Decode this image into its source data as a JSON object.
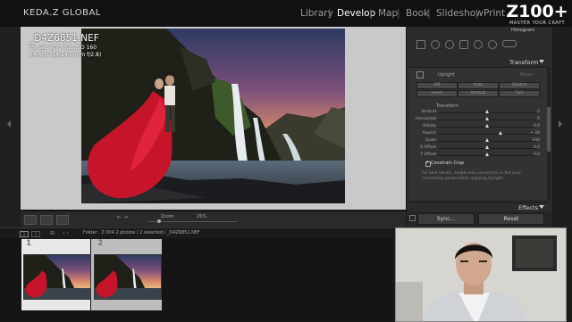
{
  "app": {
    "brand": "KEDA.Z GLOBAL"
  },
  "modules": [
    {
      "label": "Library",
      "active": false
    },
    {
      "label": "Develop",
      "active": true
    },
    {
      "label": "Map",
      "active": false
    },
    {
      "label": "Book",
      "active": false
    },
    {
      "label": "Slideshow",
      "active": false
    },
    {
      "label": "Print",
      "active": false
    }
  ],
  "module_separator": "|",
  "overlay_badge": {
    "title": "Z100+",
    "subtitle": "MASTER YOUR CRAFT"
  },
  "image_info": {
    "filename": "_D4Z6851.NEF",
    "exposure": "⅟₁₀ sec at f / 3.2, ISO 160",
    "lens": "14 mm (14-24.0 mm f/2.8)"
  },
  "toolbar": {
    "zoom_label": "Zoom",
    "zoom_value": "25%"
  },
  "right_panel": {
    "histogram_label": "Histogram",
    "transform_title": "Transform",
    "upright": {
      "label": "Upright",
      "state": "Reset",
      "buttons_row1": [
        "Off",
        "Auto",
        "Guided"
      ],
      "buttons_row2": [
        "Level",
        "Vertical",
        "Full"
      ]
    },
    "transform_section": "Transform",
    "sliders": [
      {
        "label": "Vertical",
        "value": "0",
        "position": 0.5
      },
      {
        "label": "Horizontal",
        "value": "0",
        "position": 0.5
      },
      {
        "label": "Rotate",
        "value": "0.0",
        "position": 0.5
      },
      {
        "label": "Aspect",
        "value": "+ 28",
        "position": 0.64
      },
      {
        "label": "Scale",
        "value": "100",
        "position": 0.5
      },
      {
        "label": "X Offset",
        "value": "0.0",
        "position": 0.5
      },
      {
        "label": "Y Offset",
        "value": "0.0",
        "position": 0.5
      }
    ],
    "constrain_crop": "Constrain Crop",
    "note": "For best results, enable lens corrections in the Lens Corrections panel before applying Upright.",
    "effects_title": "Effects",
    "sync_label": "Sync...",
    "reset_label": "Reset"
  },
  "filmstrip": {
    "info": "Folder : Z 004    2 photos / 2 selected / _D4Z6851.NEF",
    "cells": [
      {
        "number": "1"
      },
      {
        "number": "2"
      }
    ]
  },
  "colors": {
    "canvas_bg": "#c9c9c9",
    "panel_bg": "#2b2b2b",
    "topbar_bg": "#111111"
  }
}
